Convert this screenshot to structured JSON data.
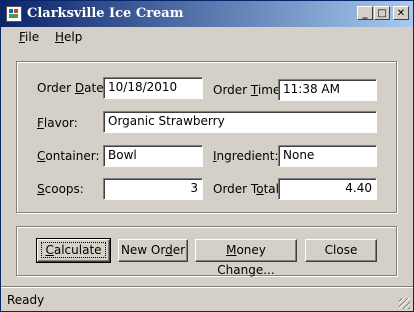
{
  "window": {
    "title": "Clarksville Ice Cream"
  },
  "caption_buttons": {
    "minimize": "_",
    "maximize": "□",
    "close": "✕"
  },
  "menu": {
    "file": {
      "accel": "F",
      "rest": "ile"
    },
    "help": {
      "accel": "H",
      "rest": "elp"
    }
  },
  "form": {
    "order_date_label": {
      "pre": "Order ",
      "accel": "D",
      "post": "ate:"
    },
    "order_date_value": "10/18/2010",
    "order_time_label": {
      "pre": "Order ",
      "accel": "T",
      "post": "ime:"
    },
    "order_time_value": "11:38 AM",
    "flavor_label": {
      "pre": "",
      "accel": "F",
      "post": "lavor:"
    },
    "flavor_value": "Organic Strawberry",
    "container_label": {
      "pre": "",
      "accel": "C",
      "post": "ontainer:"
    },
    "container_value": "Bowl",
    "ingredient_label": {
      "pre": "",
      "accel": "I",
      "post": "ngredient:"
    },
    "ingredient_value": "None",
    "scoops_label": {
      "pre": "",
      "accel": "S",
      "post": "coops:"
    },
    "scoops_value": "3",
    "order_total_label": {
      "pre": "Order T",
      "accel": "o",
      "post": "tal:"
    },
    "order_total_value": "4.40"
  },
  "buttons": {
    "calculate": {
      "pre": "",
      "accel": "C",
      "post": "alculate"
    },
    "new_order": {
      "pre": "New Or",
      "accel": "d",
      "post": "er"
    },
    "money_change": {
      "pre": "",
      "accel": "M",
      "post": "oney Change..."
    },
    "close": "Close"
  },
  "status": {
    "text": "Ready"
  }
}
